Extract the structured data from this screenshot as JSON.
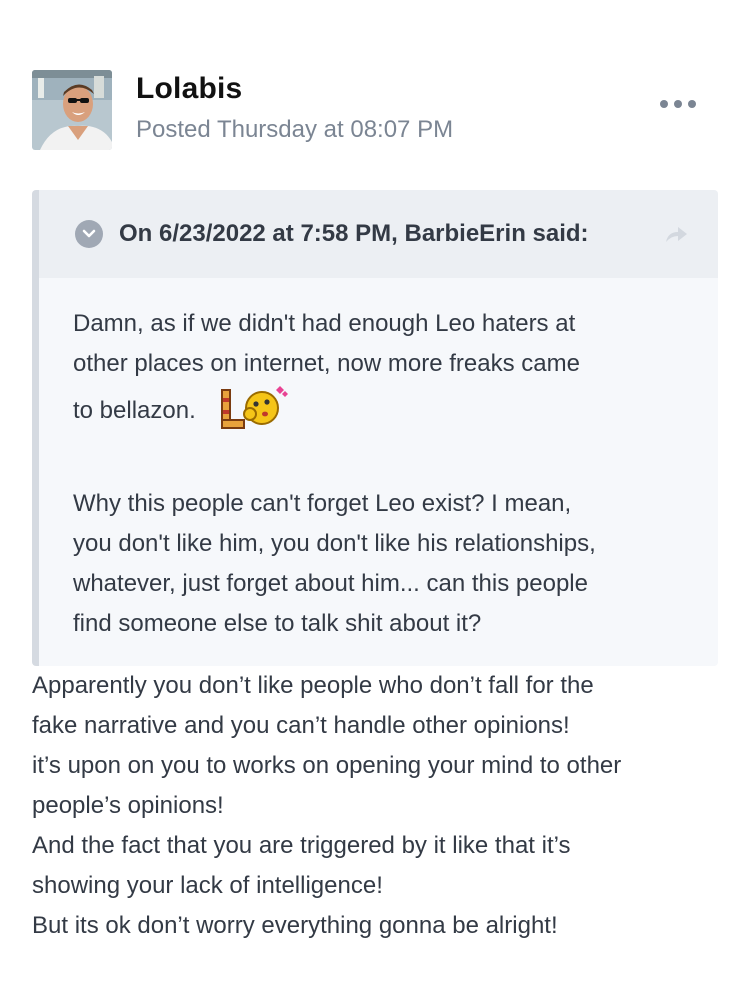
{
  "post": {
    "author": "Lolabis",
    "date": "Posted Thursday at 08:07 PM",
    "menu_icon": "ellipsis-icon"
  },
  "quote": {
    "citation": "On 6/23/2022 at 7:58 PM, BarbieErin said:",
    "lines": [
      "Damn, as if we didn't had enough Leo haters at",
      "other places on internet, now more freaks came",
      "to bellazon."
    ],
    "emoji": "kissing-emoji",
    "paragraph2": [
      "Why this people can't forget Leo exist? I mean,",
      "you don't like him, you don't like his relationships,",
      "whatever, just forget about him... can this people",
      "find someone else to talk shit about it?"
    ]
  },
  "reply": {
    "lines": [
      "Apparently you don’t like people who don’t fall for the",
      "fake narrative and you can’t handle other opinions!",
      "it’s upon on you to works on opening your mind to other",
      "people’s opinions!",
      "And the fact that you are triggered by it like that it’s",
      "showing your lack of intelligence!",
      "But its ok don’t worry everything gonna be alright!"
    ]
  }
}
